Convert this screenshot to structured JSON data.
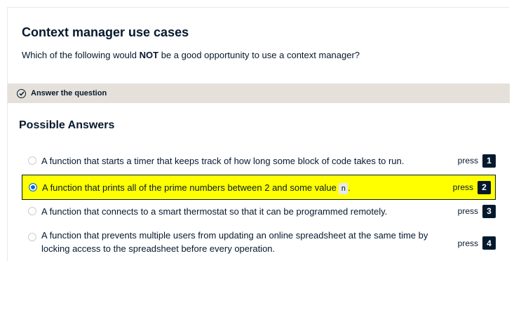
{
  "exercise": {
    "title": "Context manager use cases",
    "question_before": "Which of the following would ",
    "question_emph": "NOT",
    "question_after": " be a good opportunity to use a context manager?"
  },
  "instruction": {
    "label": "Answer the question",
    "icon": "check-circle-icon"
  },
  "answers": {
    "heading": "Possible Answers",
    "press_label": "press",
    "options": [
      {
        "text": "A function that starts a timer that keeps track of how long some block of code takes to run.",
        "key": "1",
        "selected": false
      },
      {
        "text_before": "A function that prints all of the prime numbers between 2 and some value ",
        "code": "n",
        "text_after": ".",
        "key": "2",
        "selected": true
      },
      {
        "text": "A function that connects to a smart thermostat so that it can be programmed remotely.",
        "key": "3",
        "selected": false
      },
      {
        "text": "A function that prevents multiple users from updating an online spreadsheet at the same time by locking access to the spreadsheet before every operation.",
        "key": "4",
        "selected": false
      }
    ]
  },
  "colors": {
    "text": "#05192d",
    "instruction_bg": "#e5e1da",
    "selected_bg": "#ffff00",
    "radio_selected": "#0a66d6"
  }
}
